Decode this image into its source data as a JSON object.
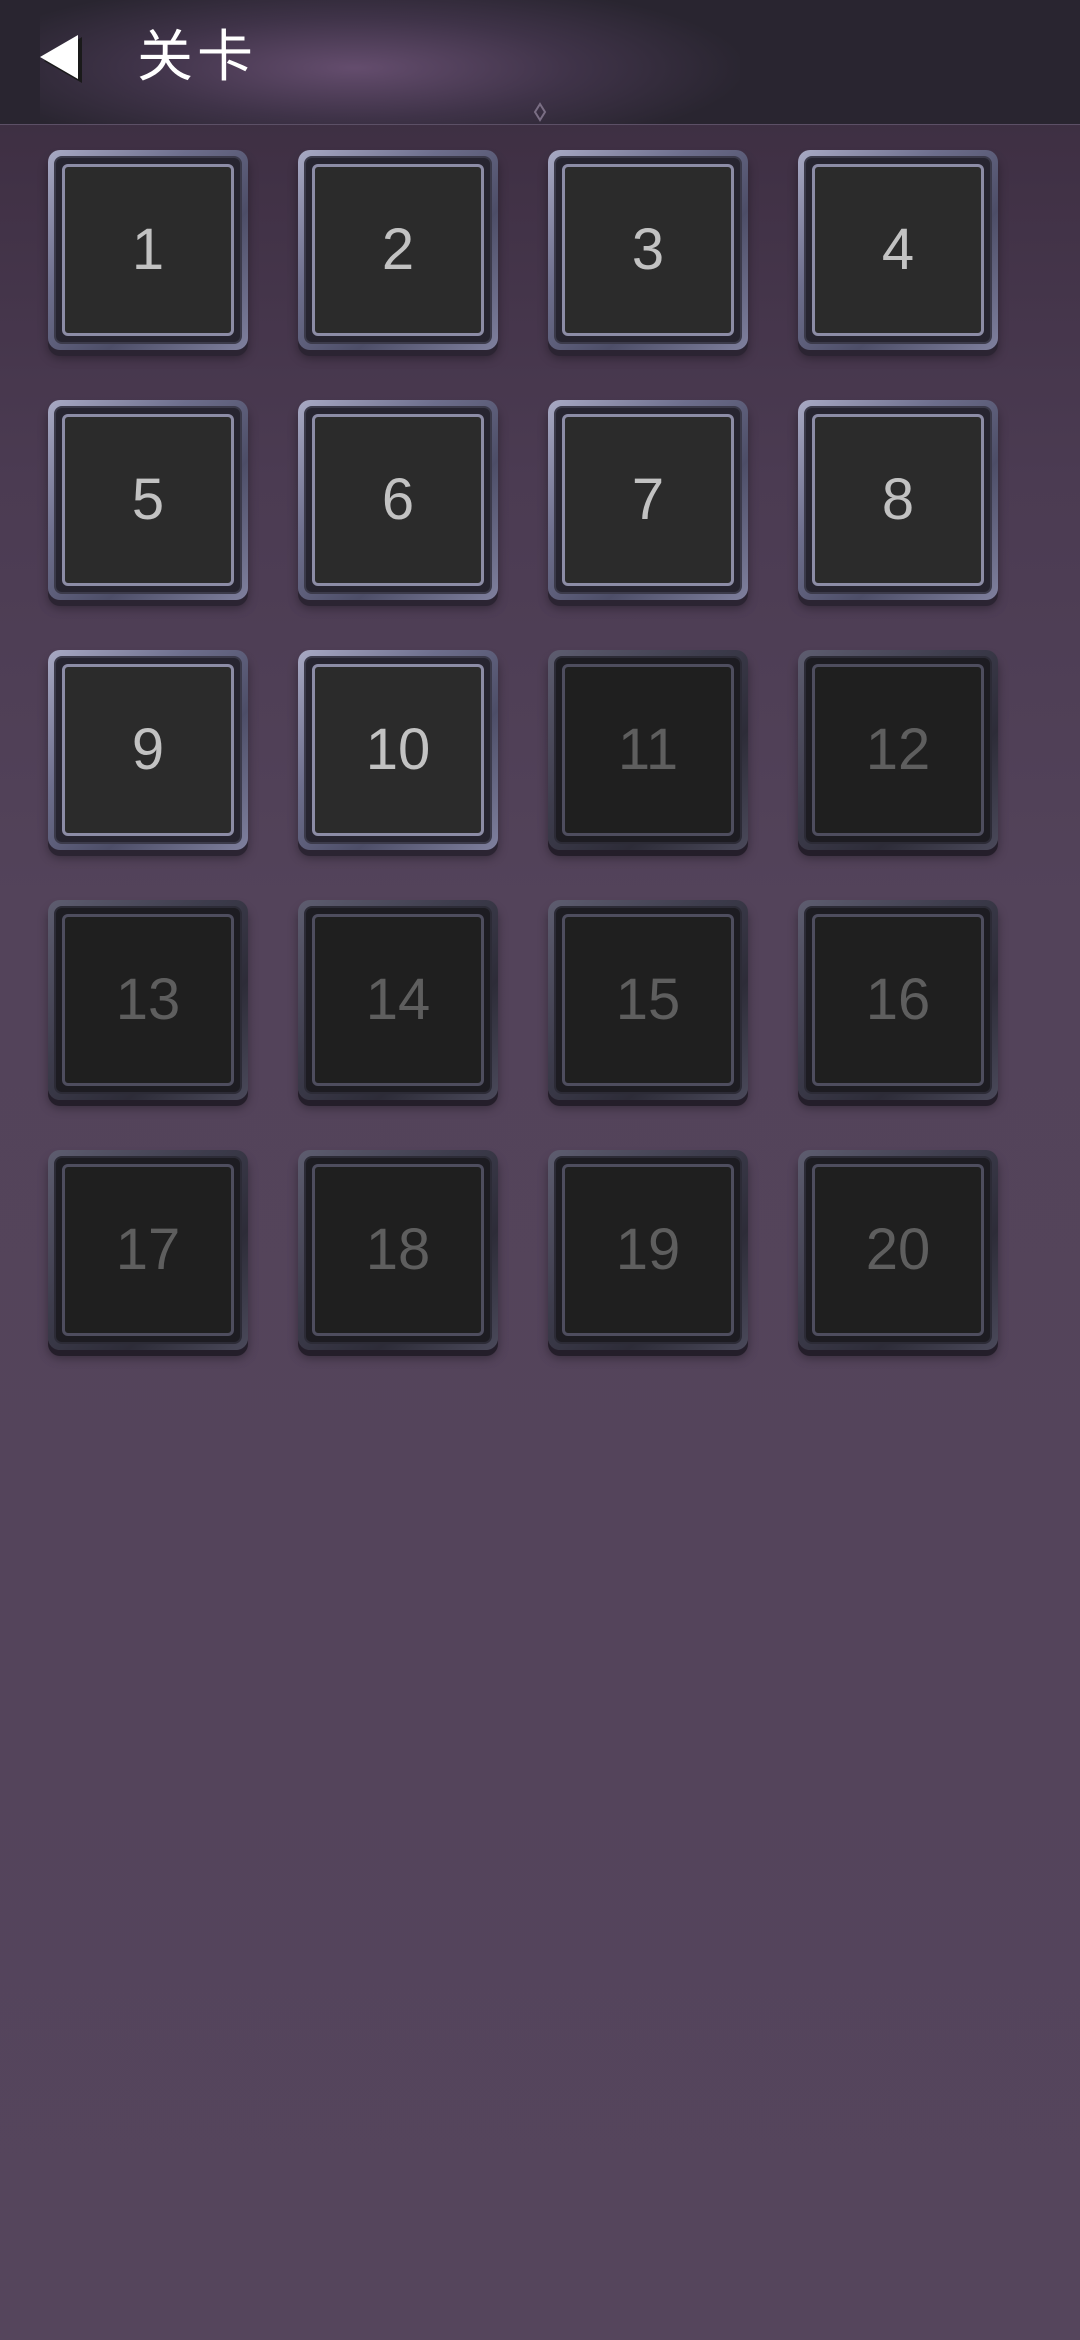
{
  "header": {
    "title": "关卡",
    "back_icon": "back-arrow-icon"
  },
  "levels": [
    {
      "number": "1",
      "unlocked": true
    },
    {
      "number": "2",
      "unlocked": true
    },
    {
      "number": "3",
      "unlocked": true
    },
    {
      "number": "4",
      "unlocked": true
    },
    {
      "number": "5",
      "unlocked": true
    },
    {
      "number": "6",
      "unlocked": true
    },
    {
      "number": "7",
      "unlocked": true
    },
    {
      "number": "8",
      "unlocked": true
    },
    {
      "number": "9",
      "unlocked": true
    },
    {
      "number": "10",
      "unlocked": true
    },
    {
      "number": "11",
      "unlocked": false
    },
    {
      "number": "12",
      "unlocked": false
    },
    {
      "number": "13",
      "unlocked": false
    },
    {
      "number": "14",
      "unlocked": false
    },
    {
      "number": "15",
      "unlocked": false
    },
    {
      "number": "16",
      "unlocked": false
    },
    {
      "number": "17",
      "unlocked": false
    },
    {
      "number": "18",
      "unlocked": false
    },
    {
      "number": "19",
      "unlocked": false
    },
    {
      "number": "20",
      "unlocked": false
    }
  ],
  "colors": {
    "background": "#53435a",
    "header_background": "#292530",
    "unlocked_number": "#c2c2c2",
    "locked_number": "#5e5e5e"
  }
}
